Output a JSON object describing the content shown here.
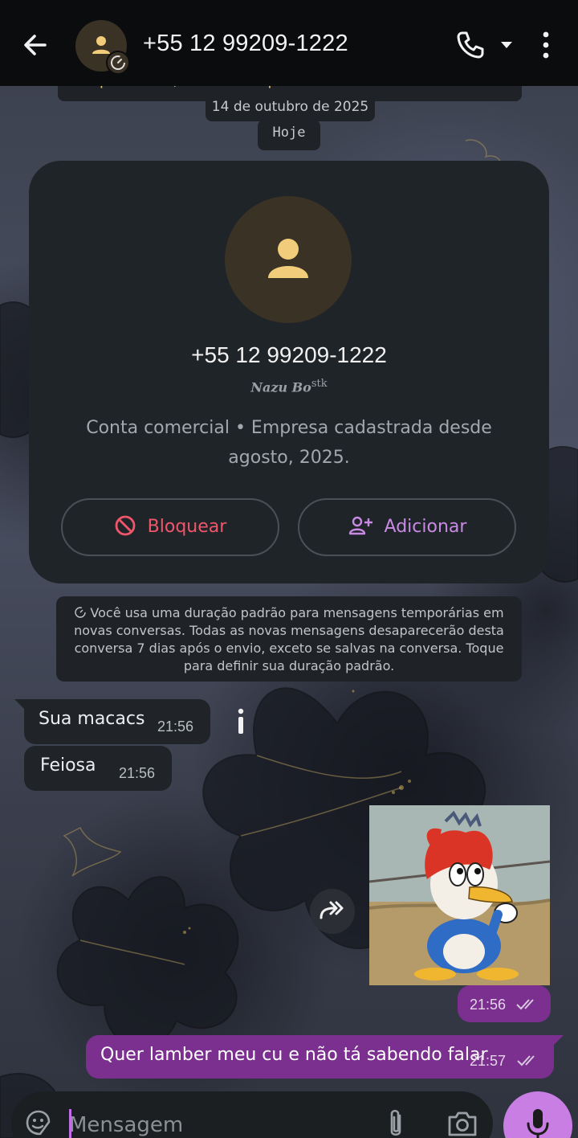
{
  "header": {
    "title": "+55 12 99209-1222",
    "back_icon": "arrow-left-icon",
    "avatar_icon": "person-icon",
    "timer_icon": "disappearing-timer-icon",
    "call_icon": "phone-icon",
    "menu_icon": "more-vertical-icon"
  },
  "previous_banner": "podem ler, ouvir e compartilhar esse conteúdo. Saiba mais",
  "dates": {
    "first": "14 de outubro de 2025",
    "today": "Hoje"
  },
  "contact_card": {
    "phone": "+55 12 99209-1222",
    "name": "Nazu Bo",
    "name_sup": "stk",
    "info": "Conta comercial • Empresa cadastrada desde agosto, 2025.",
    "block_label": "Bloquear",
    "add_label": "Adicionar"
  },
  "notice": {
    "text": "Você usa uma duração padrão para mensagens temporárias em novas conversas. Todas as novas mensagens desaparecerão desta conversa 7 dias após o envio, exceto se salvas na conversa. Toque para definir sua duração padrão."
  },
  "messages": {
    "in1": {
      "text": "Sua macacs",
      "time": "21:56"
    },
    "in2": {
      "text": "Feiosa",
      "time": "21:56"
    },
    "out_image": {
      "time": "21:56",
      "status": "read-double-check"
    },
    "out2": {
      "text": "Quer lamber meu cu e não tá sabendo falar",
      "time": "21:57",
      "status": "read-double-check"
    }
  },
  "input": {
    "placeholder": "Mensagem"
  },
  "colors": {
    "header_bg": "#0b0c0e",
    "card_bg": "#1f2428",
    "incoming_bubble": "#202428",
    "outgoing_bubble": "#7b2f8f",
    "block_red": "#f0566a",
    "add_purple": "#c98ae4",
    "mic_button": "#c97ee3"
  }
}
